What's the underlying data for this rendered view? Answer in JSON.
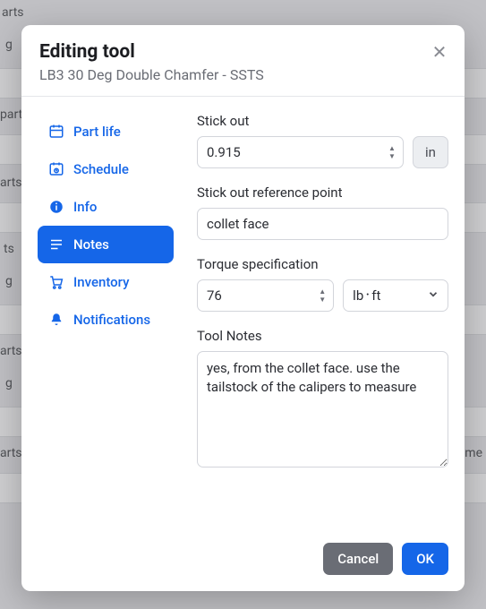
{
  "bg": {
    "labels": [
      "arts",
      "g",
      "part",
      "arts",
      "ts",
      "g",
      "arts",
      "g",
      "arts",
      "me"
    ]
  },
  "modal": {
    "title": "Editing tool",
    "subtitle": "LB3 30 Deg Double Chamfer - SSTS"
  },
  "sidebar": {
    "items": [
      {
        "label": "Part life"
      },
      {
        "label": "Schedule"
      },
      {
        "label": "Info"
      },
      {
        "label": "Notes"
      },
      {
        "label": "Inventory"
      },
      {
        "label": "Notifications"
      }
    ],
    "active_index": 3
  },
  "form": {
    "stick_out": {
      "label": "Stick out",
      "value": "0.915",
      "unit": "in"
    },
    "ref_point": {
      "label": "Stick out reference point",
      "value": "collet face"
    },
    "torque": {
      "label": "Torque specification",
      "value": "76",
      "unit": "lb᛫ft"
    },
    "notes": {
      "label": "Tool Notes",
      "value": "yes, from the collet face. use the tailstock of the calipers to measure"
    }
  },
  "footer": {
    "cancel": "Cancel",
    "ok": "OK"
  }
}
